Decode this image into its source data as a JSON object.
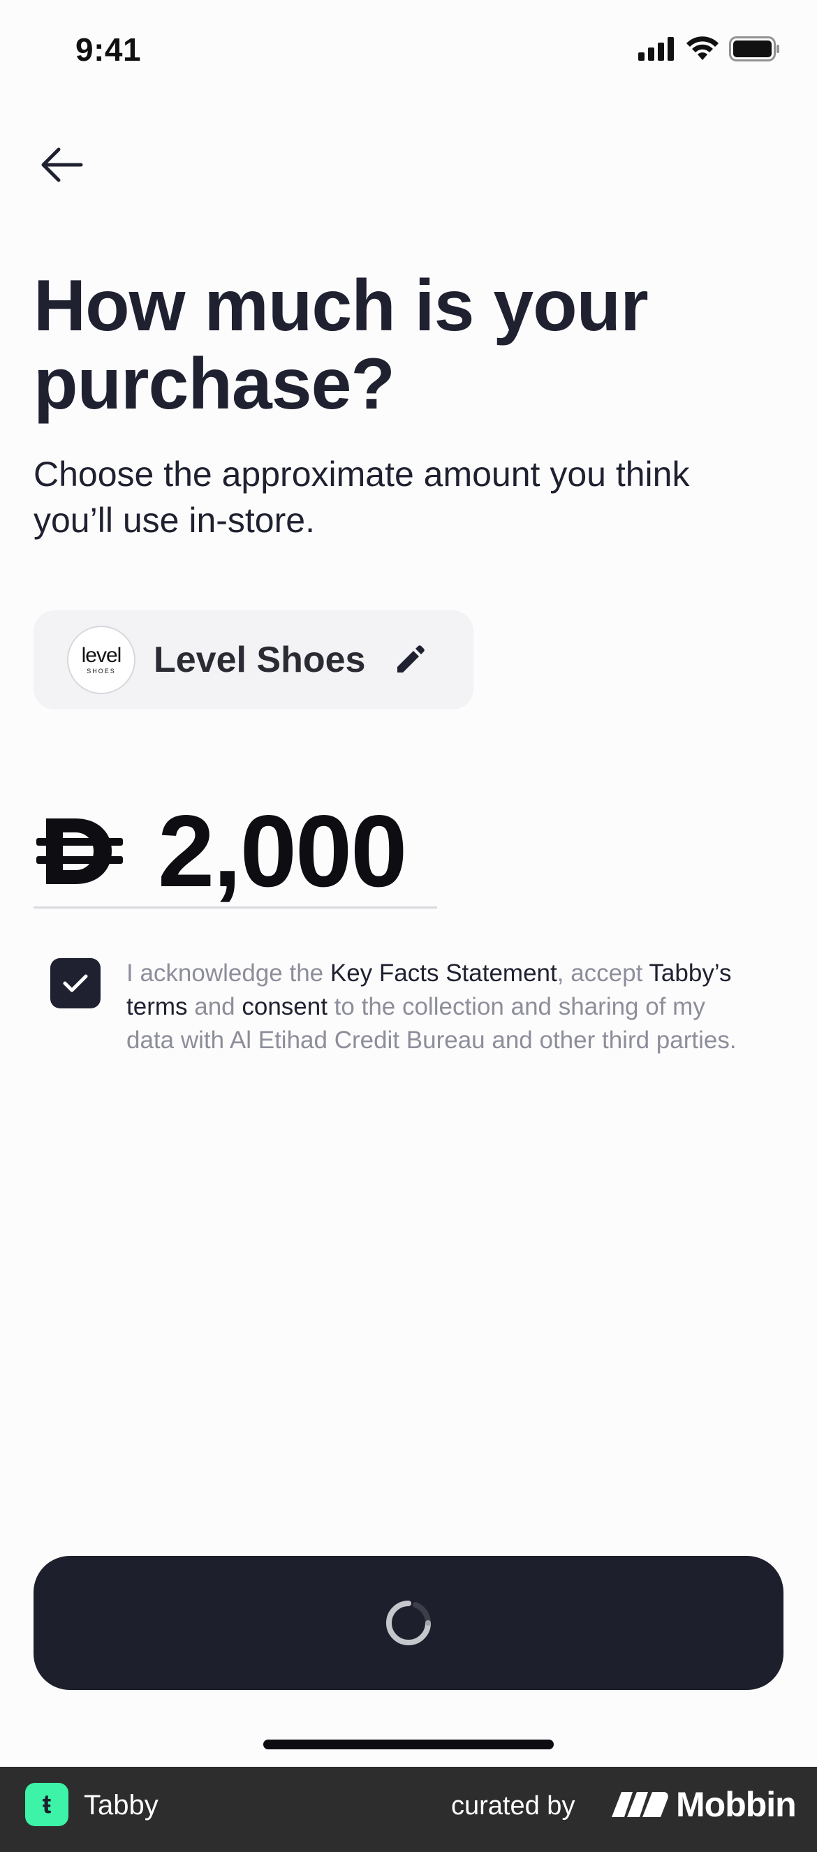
{
  "status_bar": {
    "time": "9:41"
  },
  "header": {
    "back_icon": "arrow-left-icon"
  },
  "title": "How much is your purchase?",
  "subtitle": "Choose the approximate amount you think you’ll use in-store.",
  "merchant": {
    "logo_text": "level",
    "logo_subtext": "SHOES",
    "name": "Level Shoes",
    "edit_icon": "pencil-icon"
  },
  "amount": {
    "currency_icon": "dirham-icon",
    "value": "2,000"
  },
  "consent": {
    "checked": true,
    "t1": "I acknowledge the ",
    "link_kfs": "Key Facts Statement",
    "t2": ", accept ",
    "link_terms": "Tabby’s terms",
    "t3": " and ",
    "link_consent": "consent",
    "t4": " to the collection and sharing of my data with Al Etihad Credit Bureau and other third parties."
  },
  "continue_button": {
    "state": "loading",
    "icon": "spinner-icon"
  },
  "footer": {
    "app_name": "Tabby",
    "app_logo_glyph": "ŧ",
    "curated_by": "curated by",
    "brand": "Mobbin",
    "colors": {
      "background": "#2d2d2d",
      "tabby_green": "#3cf3a8"
    }
  },
  "colors": {
    "primary_dark": "#1e1f2c",
    "muted_text": "#8d8e9a",
    "chip_bg": "#f3f2f4"
  }
}
